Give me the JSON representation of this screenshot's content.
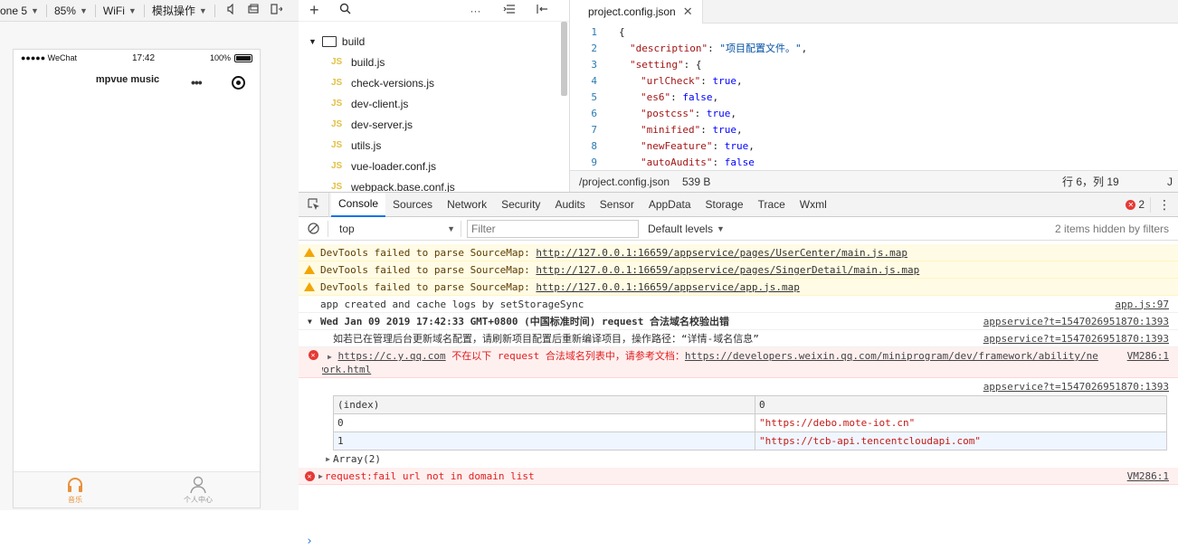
{
  "toolbar": {
    "device": "one 5",
    "zoom": "85%",
    "network": "WiFi",
    "simulate": "模拟操作"
  },
  "phone": {
    "carrier": "●●●●● WeChat",
    "time": "17:42",
    "battery": "100%",
    "title": "mpvue music",
    "tabs": [
      {
        "label": "音乐",
        "icon": "headphones-icon",
        "active": true
      },
      {
        "label": "个人中心",
        "icon": "user-icon",
        "active": false
      }
    ],
    "accent_color": "#e8913a"
  },
  "tree": {
    "folder": "build",
    "files": [
      "build.js",
      "check-versions.js",
      "dev-client.js",
      "dev-server.js",
      "utils.js",
      "vue-loader.conf.js",
      "webpack.base.conf.js"
    ],
    "file_badge": "JS"
  },
  "editor": {
    "tab_label": "project.config.json",
    "lines": [
      {
        "n": "1",
        "indent": 0,
        "text": "{"
      },
      {
        "n": "2",
        "indent": 1,
        "key": "\"description\"",
        "value": "\"项目配置文件。\"",
        "tail": ","
      },
      {
        "n": "3",
        "indent": 1,
        "key": "\"setting\"",
        "value": "{",
        "tail": ""
      },
      {
        "n": "4",
        "indent": 2,
        "key": "\"urlCheck\"",
        "value": "true",
        "tail": ","
      },
      {
        "n": "5",
        "indent": 2,
        "key": "\"es6\"",
        "value": "false",
        "tail": ","
      },
      {
        "n": "6",
        "indent": 2,
        "key": "\"postcss\"",
        "value": "true",
        "tail": ","
      },
      {
        "n": "7",
        "indent": 2,
        "key": "\"minified\"",
        "value": "true",
        "tail": ","
      },
      {
        "n": "8",
        "indent": 2,
        "key": "\"newFeature\"",
        "value": "true",
        "tail": ","
      },
      {
        "n": "9",
        "indent": 2,
        "key": "\"autoAudits\"",
        "value": "false",
        "tail": ""
      }
    ],
    "status_path": "/project.config.json",
    "status_size": "539 B",
    "status_pos": "行 6，列 19",
    "status_lang": "J"
  },
  "devtools": {
    "tabs": [
      "Console",
      "Sources",
      "Network",
      "Security",
      "Audits",
      "Sensor",
      "AppData",
      "Storage",
      "Trace",
      "Wxml"
    ],
    "active_tab": "Console",
    "error_count": "2",
    "context": "top",
    "filter_placeholder": "Filter",
    "levels": "Default levels",
    "hidden_note": "2 items hidden by filters"
  },
  "console": {
    "warn_prefix": "DevTools failed to parse SourceMap: ",
    "warnings": [
      "http://127.0.0.1:16659/appservice/pages/UserCenter/main.js.map",
      "http://127.0.0.1:16659/appservice/pages/SingerDetail/main.js.map",
      "http://127.0.0.1:16659/appservice/app.js.map"
    ],
    "log1": "app created and cache logs by setStorageSync",
    "log1_src": "app.js:97",
    "group_title": "Wed Jan 09 2019 17:42:33 GMT+0800 (中国标准时间) request 合法域名校验出错",
    "group_src": "appservice?t=1547026951870:1393",
    "info_msg": "如若已在管理后台更新域名配置，请刷新项目配置后重新编译项目，操作路径：“详情-域名信息”",
    "info_src": "appservice?t=1547026951870:1393",
    "err1_url": "https://c.y.qq.com",
    "err1_mid": " 不在以下 request 合法域名列表中，请参考文档：",
    "err1_doc": "https://developers.weixin.qq.com/miniprogram/dev/framework/ability/ne",
    "err1_doc2": "twork.html",
    "err1_src": "VM286:1",
    "table_src": "appservice?t=1547026951870:1393",
    "table_head": [
      "(index)",
      "0"
    ],
    "table_rows": [
      [
        "0",
        "\"https://debo.mote-iot.cn\""
      ],
      [
        "1",
        "\"https://tcb-api.tencentcloudapi.com\""
      ]
    ],
    "array_label": "Array(2)",
    "err2": "request:fail url not in domain list",
    "err2_src": "VM286:1"
  }
}
